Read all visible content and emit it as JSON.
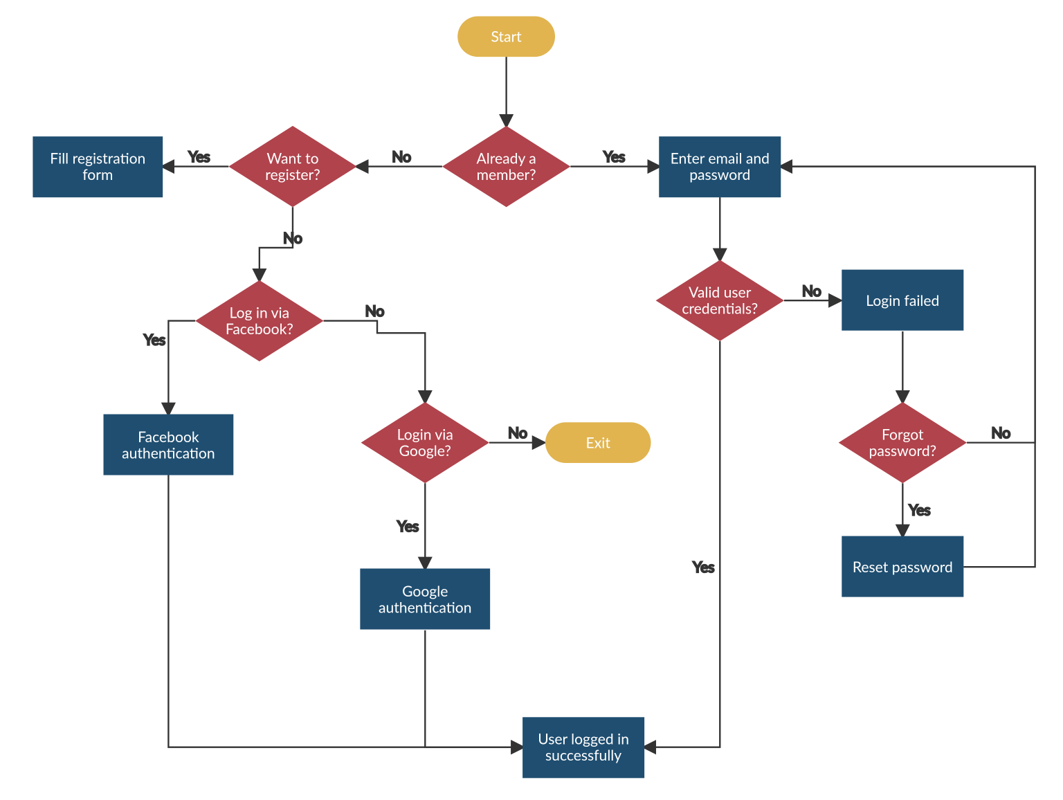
{
  "colors": {
    "terminal": "#E1B450",
    "decision": "#B0434C",
    "process": "#1F4E70",
    "edge": "#333333",
    "text_light": "#ffffff",
    "text_dark": "#333333"
  },
  "nodes": {
    "start": {
      "label": "Start"
    },
    "already_member": {
      "label1": "Already a",
      "label2": "member?"
    },
    "want_register": {
      "label1": "Want to",
      "label2": "register?"
    },
    "fill_registration": {
      "label1": "Fill registration",
      "label2": "form"
    },
    "login_facebook": {
      "label1": "Log in via",
      "label2": "Facebook?"
    },
    "facebook_auth": {
      "label1": "Facebook",
      "label2": "authentication"
    },
    "login_google": {
      "label1": "Login via",
      "label2": "Google?"
    },
    "google_auth": {
      "label1": "Google",
      "label2": "authentication"
    },
    "exit": {
      "label": "Exit"
    },
    "enter_email": {
      "label1": "Enter email and",
      "label2": "password"
    },
    "valid_credentials": {
      "label1": "Valid user",
      "label2": "credentials?"
    },
    "login_failed": {
      "label": "Login failed"
    },
    "forgot_password": {
      "label1": "Forgot",
      "label2": "password?"
    },
    "reset_password": {
      "label": "Reset password"
    },
    "logged_in": {
      "label1": "User logged in",
      "label2": "successfully"
    }
  },
  "edges": {
    "yes": "Yes",
    "no": "No"
  }
}
